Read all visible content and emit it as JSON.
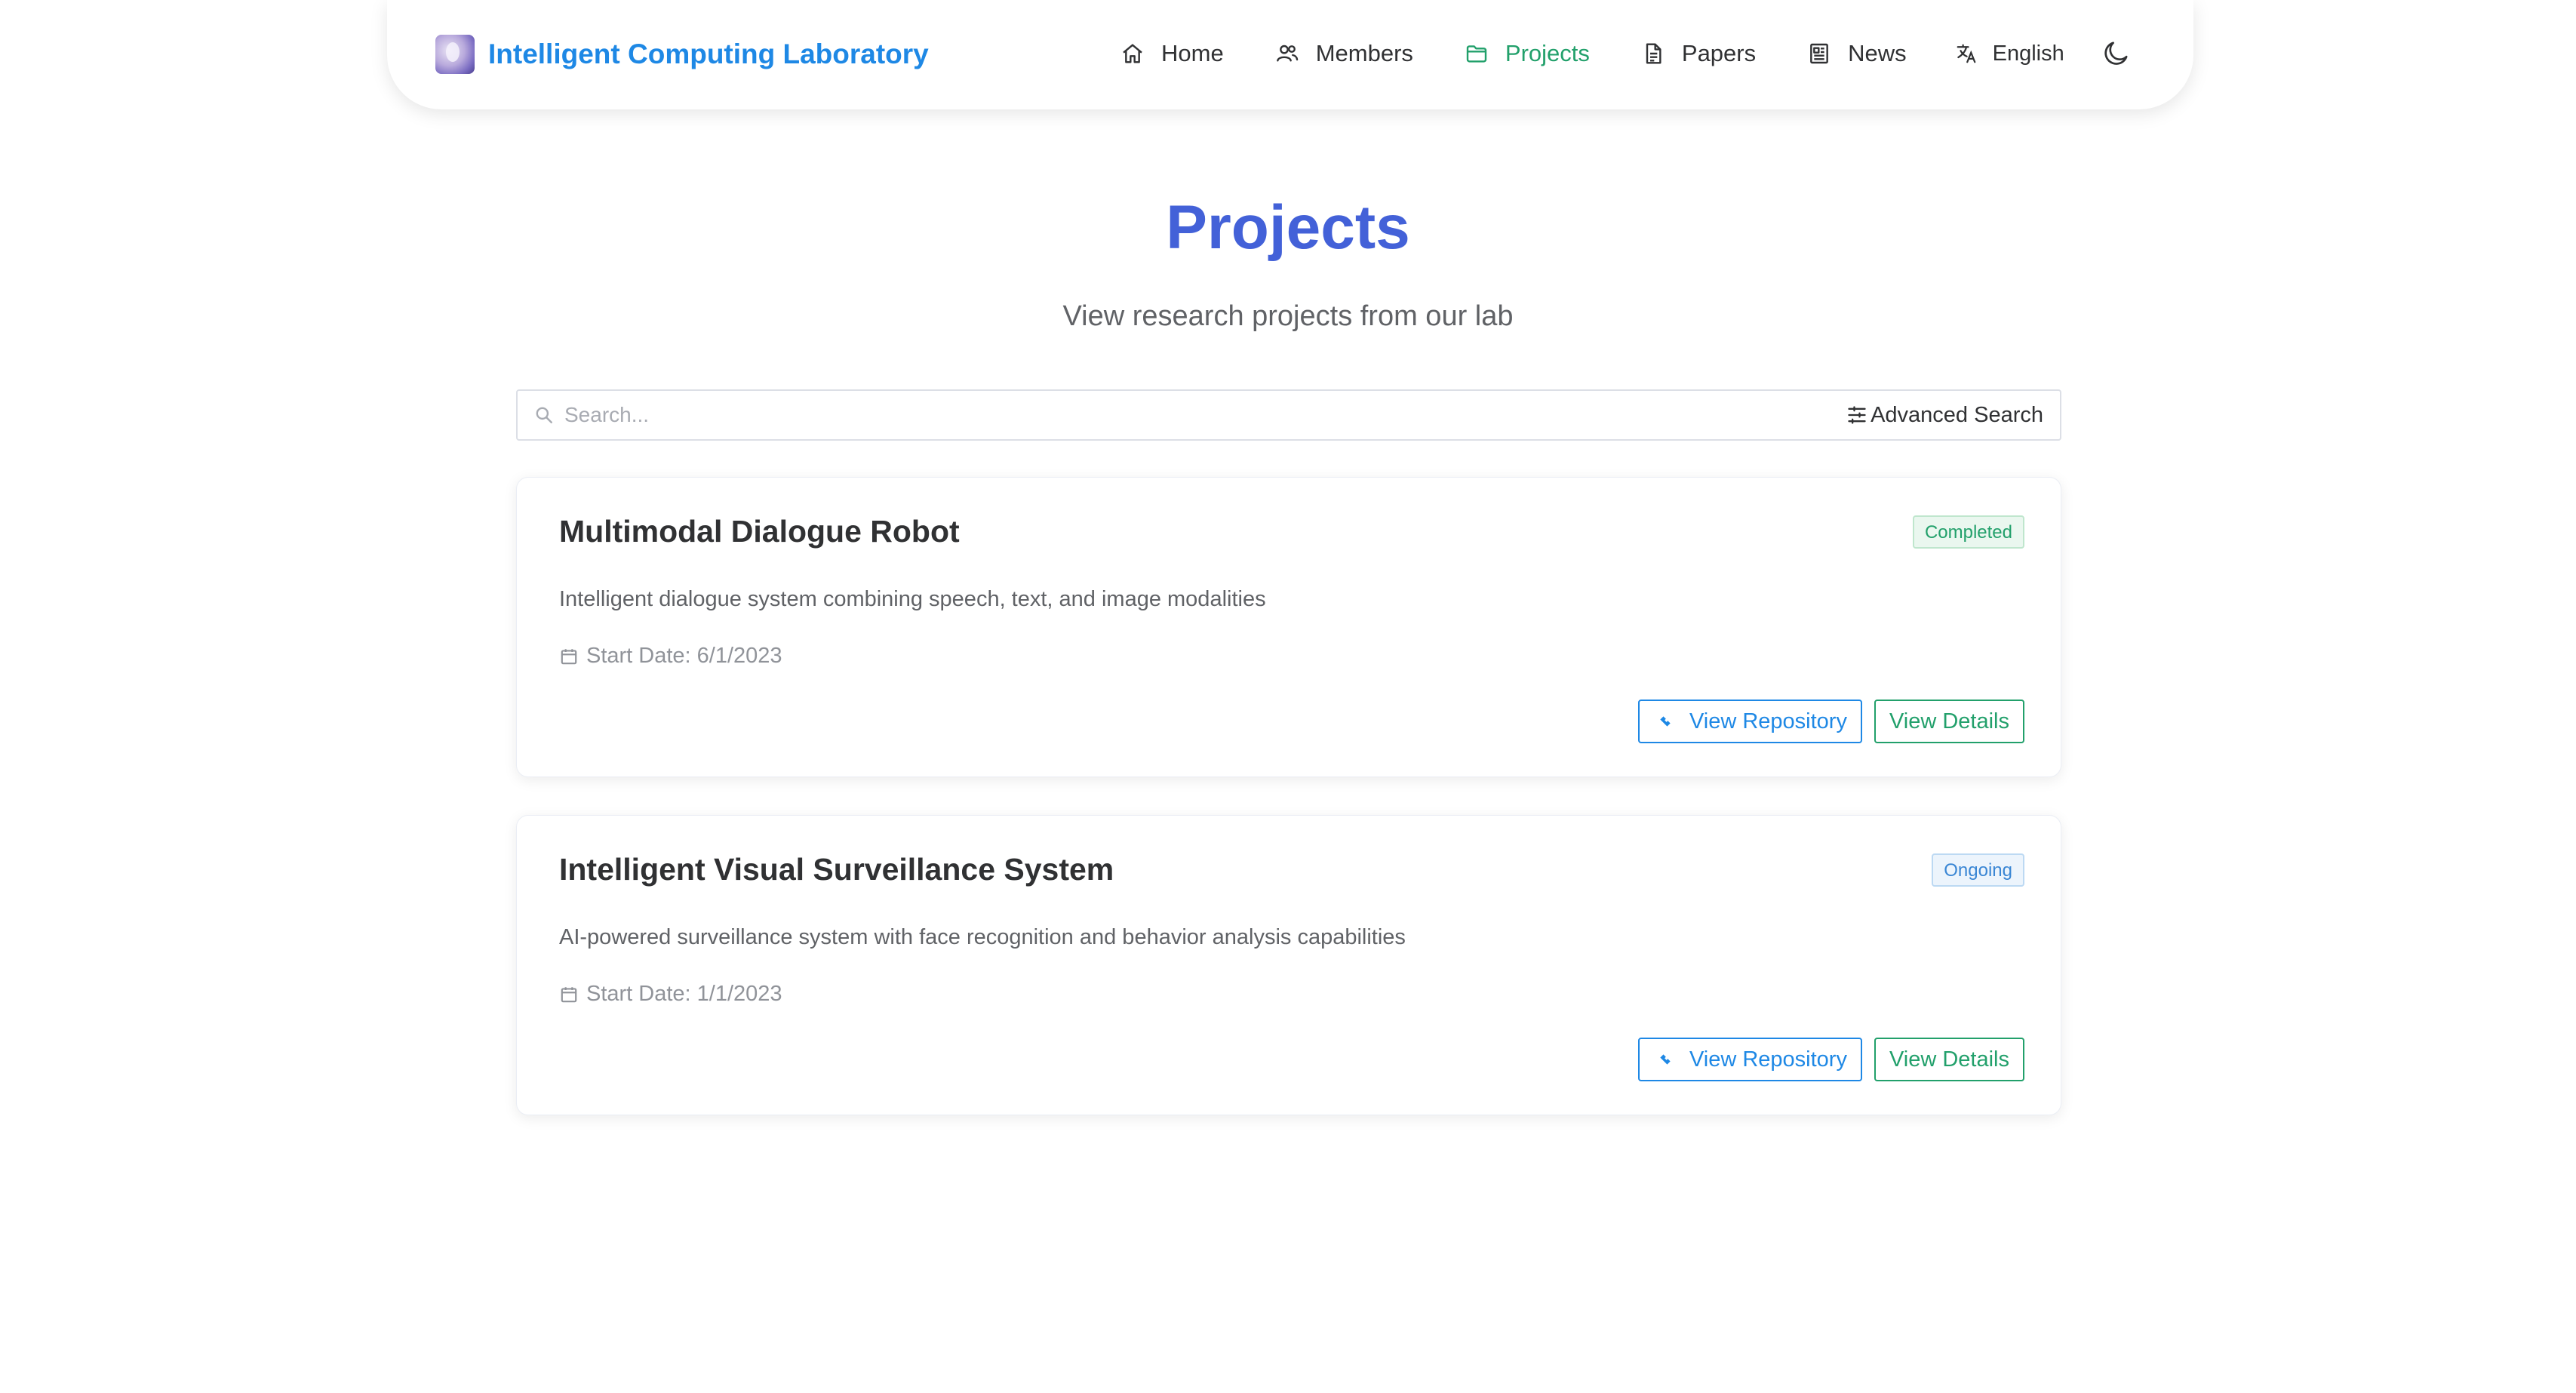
{
  "header": {
    "brand_title": "Intelligent Computing Laboratory",
    "nav": [
      {
        "label": "Home",
        "icon": "home-icon"
      },
      {
        "label": "Members",
        "icon": "users-icon"
      },
      {
        "label": "Projects",
        "icon": "folder-icon",
        "active": true
      },
      {
        "label": "Papers",
        "icon": "document-icon"
      },
      {
        "label": "News",
        "icon": "newspaper-icon"
      }
    ],
    "language": "English",
    "theme_icon": "moon-icon"
  },
  "page": {
    "title": "Projects",
    "subtitle": "View research projects from our lab"
  },
  "search": {
    "placeholder": "Search...",
    "value": "",
    "advanced_label": "Advanced Search"
  },
  "projects": [
    {
      "title": "Multimodal Dialogue Robot",
      "status": "Completed",
      "description": "Intelligent dialogue system combining speech, text, and image modalities",
      "start_date": "Start Date: 6/1/2023",
      "repo_label": "View Repository",
      "details_label": "View Details"
    },
    {
      "title": "Intelligent Visual Surveillance System",
      "status": "Ongoing",
      "description": "AI-powered surveillance system with face recognition and behavior analysis capabilities",
      "start_date": "Start Date: 1/1/2023",
      "repo_label": "View Repository",
      "details_label": "View Details"
    }
  ],
  "colors": {
    "brand": "#1e88e5",
    "title": "#4361d8",
    "active_nav": "#22a06b",
    "completed": "#22a06b",
    "ongoing": "#3a86d4"
  }
}
